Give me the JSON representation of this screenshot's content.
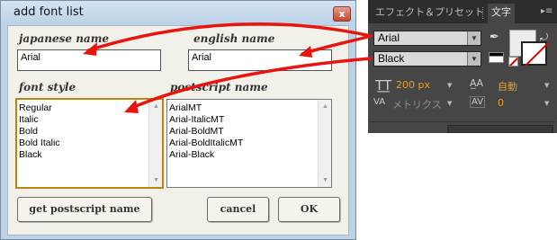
{
  "dialog": {
    "title": "add font list",
    "close_label": "x",
    "labels": {
      "japanese_name": "japanese name",
      "english_name": "english name",
      "font_style": "font style",
      "postscript_name": "postscript name"
    },
    "fields": {
      "japanese_name_value": "Arial",
      "english_name_value": "Arial"
    },
    "font_styles": [
      "Regular",
      "Italic",
      "Bold",
      "Bold Italic",
      "Black"
    ],
    "postscript_names": [
      "ArialMT",
      "Arial-ItalicMT",
      "Arial-BoldMT",
      "Arial-BoldItalicMT",
      "Arial-Black"
    ],
    "buttons": {
      "get_postscript": "get postscript name",
      "cancel": "cancel",
      "ok": "OK"
    }
  },
  "panel": {
    "tabs": [
      "エフェクト＆プリセット",
      "文字"
    ],
    "font_family": "Arial",
    "font_style": "Black",
    "font_size": "200 px",
    "leading": "自動",
    "kerning": "メトリクス",
    "tracking": "0",
    "colors": {
      "panel_bg": "#464646",
      "tabbar_bg": "#2d2d2d",
      "value_orange": "#e8a018"
    }
  },
  "annotation": {
    "arrow_color": "#e8140f"
  },
  "icons": {
    "close": "close-icon",
    "dropdown": "chevron-down-icon",
    "eyedropper": "eyedropper-icon",
    "swap": "swap-colors-icon",
    "panel_menu": "panel-menu-icon"
  }
}
